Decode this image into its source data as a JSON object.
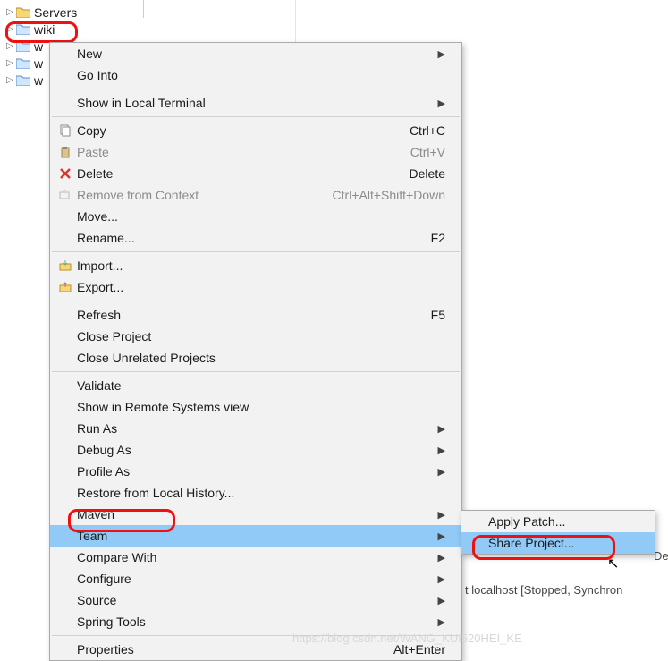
{
  "tree": {
    "items": [
      {
        "label": "Servers",
        "expandable": true
      },
      {
        "label": "wiki",
        "expandable": true
      },
      {
        "label": "w",
        "expandable": true
      },
      {
        "label": "w",
        "expandable": true
      },
      {
        "label": "w",
        "expandable": true
      }
    ]
  },
  "menu": {
    "items": [
      {
        "label": "New",
        "submenu": true
      },
      {
        "label": "Go Into"
      },
      {
        "sep": true
      },
      {
        "label": "Show in Local Terminal",
        "submenu": true
      },
      {
        "sep": true
      },
      {
        "label": "Copy",
        "accel": "Ctrl+C",
        "icon": "copy"
      },
      {
        "label": "Paste",
        "accel": "Ctrl+V",
        "icon": "paste",
        "disabled": true
      },
      {
        "label": "Delete",
        "accel": "Delete",
        "icon": "delete"
      },
      {
        "label": "Remove from Context",
        "accel": "Ctrl+Alt+Shift+Down",
        "icon": "remove-context",
        "disabled": true
      },
      {
        "label": "Move..."
      },
      {
        "label": "Rename...",
        "accel": "F2"
      },
      {
        "sep": true
      },
      {
        "label": "Import...",
        "icon": "import"
      },
      {
        "label": "Export...",
        "icon": "export"
      },
      {
        "sep": true
      },
      {
        "label": "Refresh",
        "accel": "F5"
      },
      {
        "label": "Close Project"
      },
      {
        "label": "Close Unrelated Projects"
      },
      {
        "sep": true
      },
      {
        "label": "Validate"
      },
      {
        "label": "Show in Remote Systems view"
      },
      {
        "label": "Run As",
        "submenu": true
      },
      {
        "label": "Debug As",
        "submenu": true
      },
      {
        "label": "Profile As",
        "submenu": true
      },
      {
        "label": "Restore from Local History..."
      },
      {
        "label": "Maven",
        "submenu": true
      },
      {
        "label": "Team",
        "submenu": true,
        "highlight": true
      },
      {
        "label": "Compare With",
        "submenu": true
      },
      {
        "label": "Configure",
        "submenu": true
      },
      {
        "label": "Source",
        "submenu": true
      },
      {
        "label": "Spring Tools",
        "submenu": true
      },
      {
        "sep": true
      },
      {
        "label": "Properties",
        "accel": "Alt+Enter"
      }
    ]
  },
  "submenu": {
    "items": [
      {
        "label": "Apply Patch..."
      },
      {
        "label": "Share Project...",
        "highlight": true
      }
    ]
  },
  "status_text": "t localhost  [Stopped, Synchron",
  "side_label": "De",
  "watermark": "https://blog.csdn.net/WANG_KUI520HEI_KE"
}
